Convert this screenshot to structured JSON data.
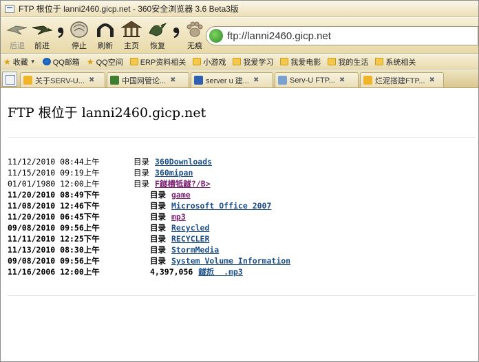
{
  "window": {
    "title": "FTP 根位于 lanni2460.gicp.net - 360安全浏览器 3.6 Beta3版"
  },
  "nav": {
    "back": "后退",
    "forward": "前进",
    "stop": "停止",
    "refresh": "刷新",
    "home": "主页",
    "restore": "恢复",
    "incognito": "无痕",
    "address": "ftp://lanni2460.gicp.net"
  },
  "bookmarks": [
    {
      "label": "收藏",
      "icon": "star-icon"
    },
    {
      "label": "QQ邮箱",
      "icon": "qq-icon"
    },
    {
      "label": "QQ空间",
      "icon": "star-icon"
    },
    {
      "label": "ERP资料相关",
      "icon": "folder-icon"
    },
    {
      "label": "小游戏",
      "icon": "folder-icon"
    },
    {
      "label": "我爱学习",
      "icon": "folder-icon"
    },
    {
      "label": "我爱电影",
      "icon": "folder-icon"
    },
    {
      "label": "我的生活",
      "icon": "folder-icon"
    },
    {
      "label": "系统相关",
      "icon": "folder-icon"
    }
  ],
  "tabs": [
    {
      "label": "关于SERV-U...",
      "icon": "lightbulb-icon"
    },
    {
      "label": "中国网管论...",
      "icon": "green-page-icon"
    },
    {
      "label": "server u 建...",
      "icon": "paw-icon"
    },
    {
      "label": "Serv-U FTP...",
      "icon": "page-icon"
    },
    {
      "label": "烂泥搭建FTP...",
      "icon": "lightbulb-icon"
    }
  ],
  "page": {
    "heading": "FTP 根位于 lanni2460.gicp.net",
    "entries": [
      {
        "date": "11/12/2010 08:44上午",
        "kind": "目录",
        "name": "360Downloads",
        "bold": false,
        "visited": false
      },
      {
        "date": "11/15/2010 09:19上午",
        "kind": "目录",
        "name": "360mipan",
        "bold": false,
        "visited": false
      },
      {
        "date": "01/01/1980 12:00上午",
        "kind": "目录",
        "name": "F鐩樻牴鐩?/B>",
        "bold": false,
        "visited": true
      },
      {
        "date": "11/20/2010 08:49下午",
        "kind": "目录",
        "name": "game",
        "bold": true,
        "visited": true
      },
      {
        "date": "11/08/2010 12:46下午",
        "kind": "目录",
        "name": "Microsoft Office 2007",
        "bold": true,
        "visited": false
      },
      {
        "date": "11/20/2010 06:45下午",
        "kind": "目录",
        "name": "mp3",
        "bold": true,
        "visited": true
      },
      {
        "date": "09/08/2010 09:56上午",
        "kind": "目录",
        "name": "Recycled",
        "bold": true,
        "visited": false
      },
      {
        "date": "11/11/2010 12:25下午",
        "kind": "目录",
        "name": "RECYCLER",
        "bold": true,
        "visited": false
      },
      {
        "date": "11/13/2010 08:30上午",
        "kind": "目录",
        "name": "StormMedia",
        "bold": true,
        "visited": false
      },
      {
        "date": "09/08/2010 09:56上午",
        "kind": "目录",
        "name": "System Volume Information",
        "bold": true,
        "visited": false
      },
      {
        "date": "11/16/2006 12:00上午",
        "kind": "4,397,056",
        "name": "鐩焎  .mp3",
        "bold": true,
        "visited": false
      }
    ]
  }
}
